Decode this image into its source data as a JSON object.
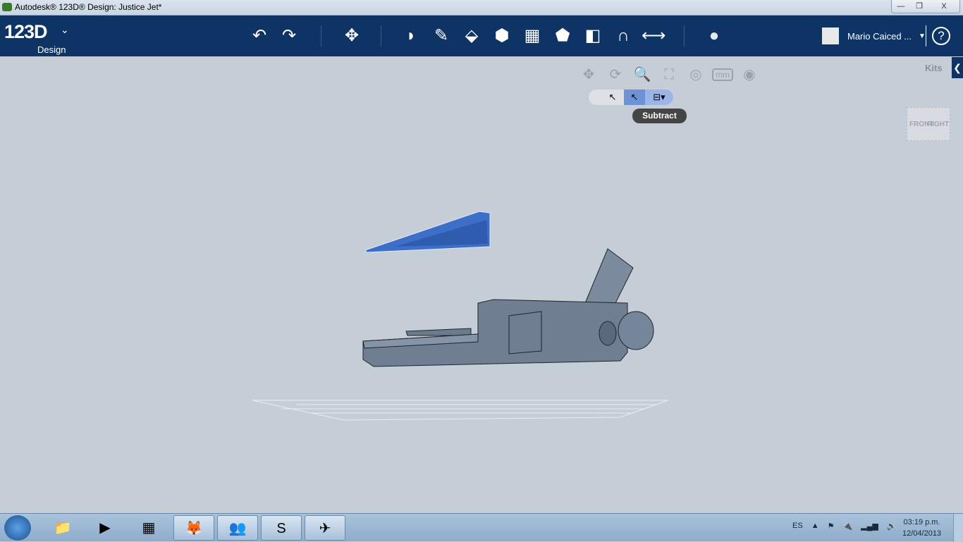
{
  "window": {
    "title": "Autodesk® 123D® Design: Justice Jet*",
    "controls": [
      "—",
      "❐",
      "X"
    ]
  },
  "header": {
    "logo": "123D",
    "logo_sub": "Design",
    "user": "Mario Caiced ...",
    "help": "?",
    "tools": [
      {
        "icon": "undo-icon",
        "g": "↶"
      },
      {
        "icon": "redo-icon",
        "g": "↷"
      },
      {
        "icon": "transform-icon",
        "g": "✥"
      },
      {
        "icon": "primitives-icon",
        "g": "◗"
      },
      {
        "icon": "sketch-icon",
        "g": "✎"
      },
      {
        "icon": "construct-icon",
        "g": "⬙"
      },
      {
        "icon": "modify-icon",
        "g": "⬢"
      },
      {
        "icon": "pattern-icon",
        "g": "▦"
      },
      {
        "icon": "grouping-icon",
        "g": "⬟"
      },
      {
        "icon": "combine-icon",
        "g": "◧"
      },
      {
        "icon": "snap-icon",
        "g": "∩"
      },
      {
        "icon": "measure-icon",
        "g": "⟷"
      },
      {
        "icon": "material-icon",
        "g": "●"
      }
    ]
  },
  "nav": {
    "items": [
      {
        "icon": "pan-icon",
        "g": "✥"
      },
      {
        "icon": "orbit-icon",
        "g": "⟳"
      },
      {
        "icon": "zoom-icon",
        "g": "🔍"
      },
      {
        "icon": "fit-icon",
        "g": "⛶"
      },
      {
        "icon": "view-style-icon",
        "g": "◎"
      },
      {
        "icon": "units-icon",
        "g": "mm"
      },
      {
        "icon": "visibility-icon",
        "g": "◉"
      }
    ]
  },
  "selection": {
    "tooltip": "Subtract"
  },
  "kits": {
    "label": "Kits"
  },
  "viewcube": {
    "right": "RIGHT",
    "front": "FRONT"
  },
  "taskbar": {
    "lang": "ES",
    "time": "03:19 p.m.",
    "date": "12/04/2013"
  },
  "colors": {
    "header": "#0e3466",
    "viewport": "#c5cdd7",
    "selected_part": "#3d6fc8",
    "model": "#6f7f91"
  }
}
